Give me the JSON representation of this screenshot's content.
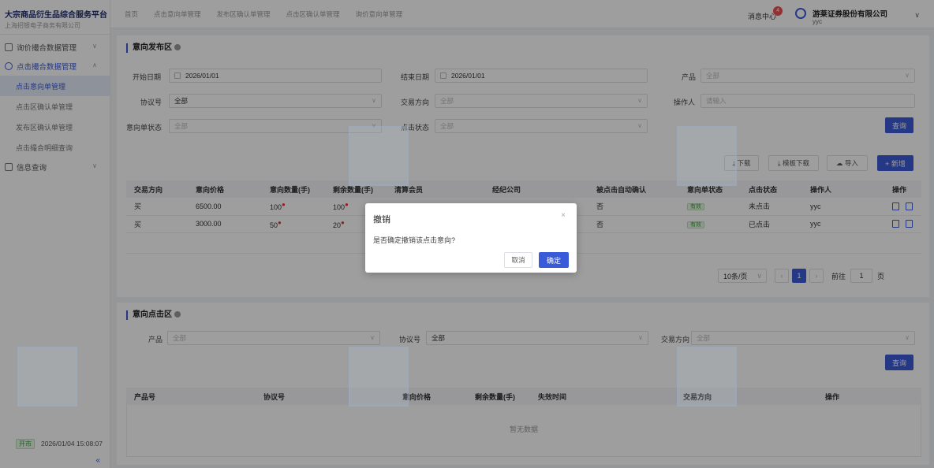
{
  "brand": {
    "title": "大宗商品衍生品综合服务平台",
    "subtitle": "上海招银电子商务有限公司"
  },
  "sidebar": {
    "groups": [
      {
        "label": "询价撮合数据管理"
      },
      {
        "label": "点击撮合数据管理",
        "items": [
          "点击意向单管理",
          "点击区确认单管理",
          "发布区确认单管理",
          "点击撮合明细查询"
        ]
      },
      {
        "label": "信息查询"
      }
    ],
    "footer": {
      "status": "开市",
      "datetime": "2026/01/04 15:08:07",
      "collapse": "«"
    }
  },
  "topbar": {
    "tabs": [
      "首页",
      "点击意向单管理",
      "发布区确认单管理",
      "点击区确认单管理",
      "询价意向单管理"
    ],
    "message": "消息中心",
    "message_count": "4",
    "company": "游莱证券股份有限公司",
    "user": "yyc"
  },
  "publish": {
    "title": "意向发布区",
    "filters": {
      "start_label": "开始日期",
      "start_value": "2026/01/01",
      "end_label": "结束日期",
      "end_value": "2026/01/01",
      "product_label": "产品",
      "product_value": "全部",
      "protocol_label": "协议号",
      "protocol_value": "全部",
      "direction_label": "交易方向",
      "direction_value": "全部",
      "operator_label": "操作人",
      "operator_placeholder": "请输入",
      "status_label": "意向单状态",
      "status_value": "全部",
      "click_label": "点击状态",
      "click_value": "全部"
    },
    "query": "查询",
    "toolbar": {
      "download": "下载",
      "template": "模板下载",
      "import": "导入",
      "add": "+ 新增"
    },
    "columns": [
      "交易方向",
      "意向价格",
      "意向数量(手)",
      "剩余数量(手)",
      "清算会员",
      "经纪公司",
      "被点击自动确认",
      "意向单状态",
      "点击状态",
      "操作人",
      "操作"
    ],
    "rows": [
      [
        "买",
        "6500.00",
        "100",
        "100",
        "",
        "",
        "否",
        "有效",
        "未点击",
        "yyc"
      ],
      [
        "买",
        "3000.00",
        "50",
        "20",
        "",
        "",
        "否",
        "有效",
        "已点击",
        "yyc"
      ]
    ],
    "pager": {
      "size": "10条/页",
      "page": "1",
      "goto": "前往",
      "goto_value": "1",
      "unit": "页"
    }
  },
  "click_area": {
    "title": "意向点击区",
    "filters": {
      "product_label": "产品",
      "product_value": "全部",
      "protocol_label": "协议号",
      "protocol_value": "全部",
      "direction_label": "交易方向",
      "direction_value": "全部"
    },
    "query": "查询",
    "columns": [
      "产品号",
      "协议号",
      "意向价格",
      "剩余数量(手)",
      "失效时间",
      "交易方向",
      "操作"
    ],
    "empty": "暂无数据"
  },
  "dialog": {
    "title": "撤销",
    "message": "是否确定撤销该点击意向?",
    "cancel": "取消",
    "confirm": "确定",
    "close": "×"
  }
}
